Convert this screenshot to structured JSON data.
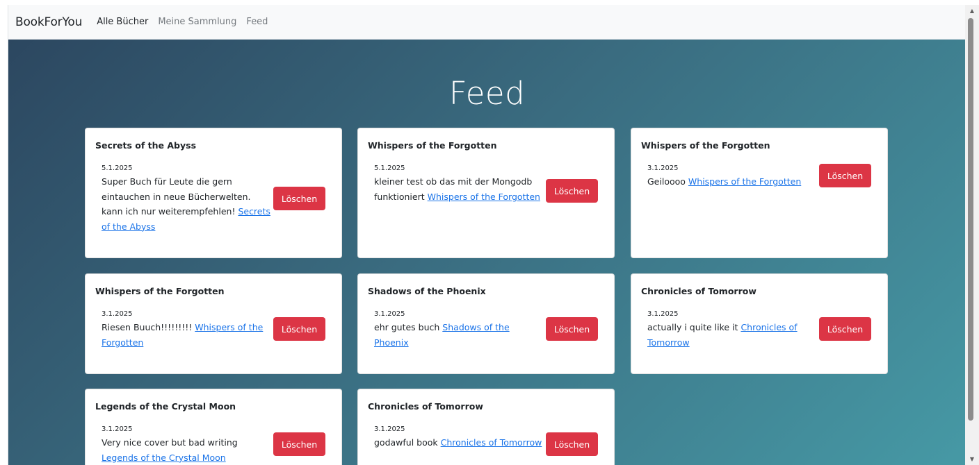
{
  "navbar": {
    "brand": "BookForYou",
    "links": [
      "Alle Bücher",
      "Meine Sammlung",
      "Feed"
    ]
  },
  "page": {
    "title": "Feed"
  },
  "delete_label": "Löschen",
  "posts": [
    {
      "title": "Secrets of the Abyss",
      "date": "5.1.2025",
      "text": "Super Buch für Leute die gern eintauchen in neue Bücherwelten. kann ich nur weiterempfehlen!",
      "link": "Secrets of the Abyss"
    },
    {
      "title": "Whispers of the Forgotten",
      "date": "5.1.2025",
      "text": "kleiner test ob das mit der Mongodb funktioniert",
      "link": "Whispers of the Forgotten"
    },
    {
      "title": "Whispers of the Forgotten",
      "date": "3.1.2025",
      "text": "Geiloooo",
      "link": "Whispers of the Forgotten"
    },
    {
      "title": "Whispers of the Forgotten",
      "date": "3.1.2025",
      "text": "Riesen Buuch!!!!!!!!!",
      "link": "Whispers of the Forgotten"
    },
    {
      "title": "Shadows of the Phoenix",
      "date": "3.1.2025",
      "text": "ehr gutes buch",
      "link": "Shadows of the Phoenix"
    },
    {
      "title": "Chronicles of Tomorrow",
      "date": "3.1.2025",
      "text": "actually i quite like it",
      "link": "Chronicles of Tomorrow"
    },
    {
      "title": "Legends of the Crystal Moon",
      "date": "3.1.2025",
      "text": "Very nice cover but bad writing",
      "link": "Legends of the Crystal Moon"
    },
    {
      "title": "Chronicles of Tomorrow",
      "date": "3.1.2025",
      "text": "godawful book",
      "link": "Chronicles of Tomorrow"
    }
  ],
  "colors": {
    "delete_button": "#dc3545",
    "link": "#1a73e8",
    "hero_gradient_start": "#2c4760",
    "hero_gradient_end": "#4699a5"
  }
}
